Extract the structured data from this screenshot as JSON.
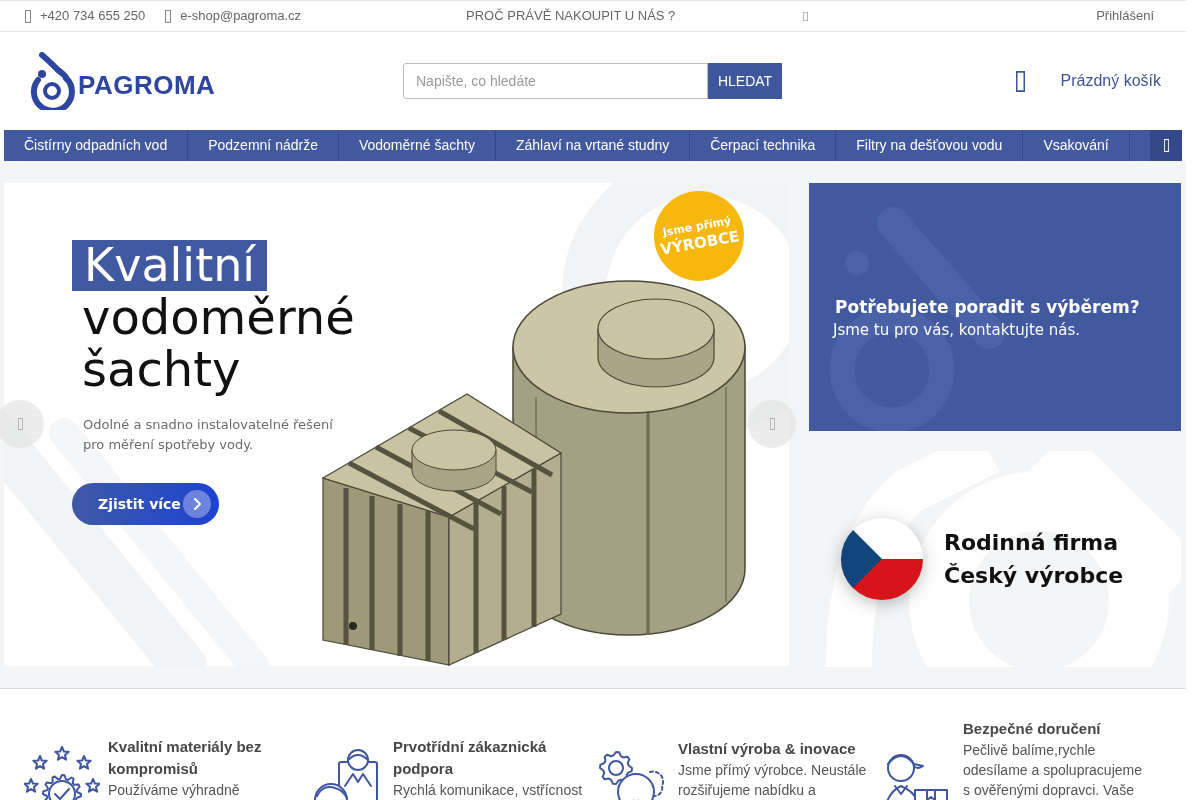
{
  "top_bar": {
    "phone": "+420 734 655 250",
    "email": "e-shop@pagroma.cz",
    "why_link": "PROČ PRÁVĚ NAKOUPIT U NÁS ?",
    "login": "Přihlášení"
  },
  "header": {
    "logo": "PAGROMA",
    "search": {
      "placeholder": "Napište, co hledáte",
      "button": "HLEDAT"
    },
    "cart": "Prázdný košík"
  },
  "nav": [
    "Čistírny odpadních vod",
    "Podzemní nádrže",
    "Vodoměrné šachty",
    "Záhlaví na vrtané studny",
    "Čerpací technika",
    "Filtry na dešťovou vodu",
    "Vsakování"
  ],
  "hero": {
    "highlight": "Kvalitní",
    "title": "vodoměrné\nšachty",
    "subtitle": "Odolné a snadno instalovatelné řešení\npro měření spotřeby vody.",
    "button": "Zjistit více",
    "badge": {
      "top": "Jsme přímý",
      "bottom": "VÝROBCE"
    }
  },
  "side_banners": [
    {
      "kind": "contact",
      "title": "Potřebujete poradit s výběrem?",
      "text": "Jsme tu pro vás, kontaktujte nás."
    },
    {
      "kind": "flag",
      "text": "Rodinná firma\nČeský výrobce"
    }
  ],
  "features": [
    {
      "title": "Kvalitní materiály bez kompromisů",
      "text": "Používáme výhradně"
    },
    {
      "title": "Prvotřídní zákaznická podpora",
      "text": "Rychlá komunikace, vstřícnost"
    },
    {
      "title": "Vlastní výroba & inovace",
      "text": "Jsme přímý výrobce. Neustále rozšiřujeme nabídku a"
    },
    {
      "title": "Bezpečné doručení",
      "text": "Pečlivě balíme,rychle odesílame a spolupracujeme s ověřenými dopravci. Vaše"
    }
  ]
}
